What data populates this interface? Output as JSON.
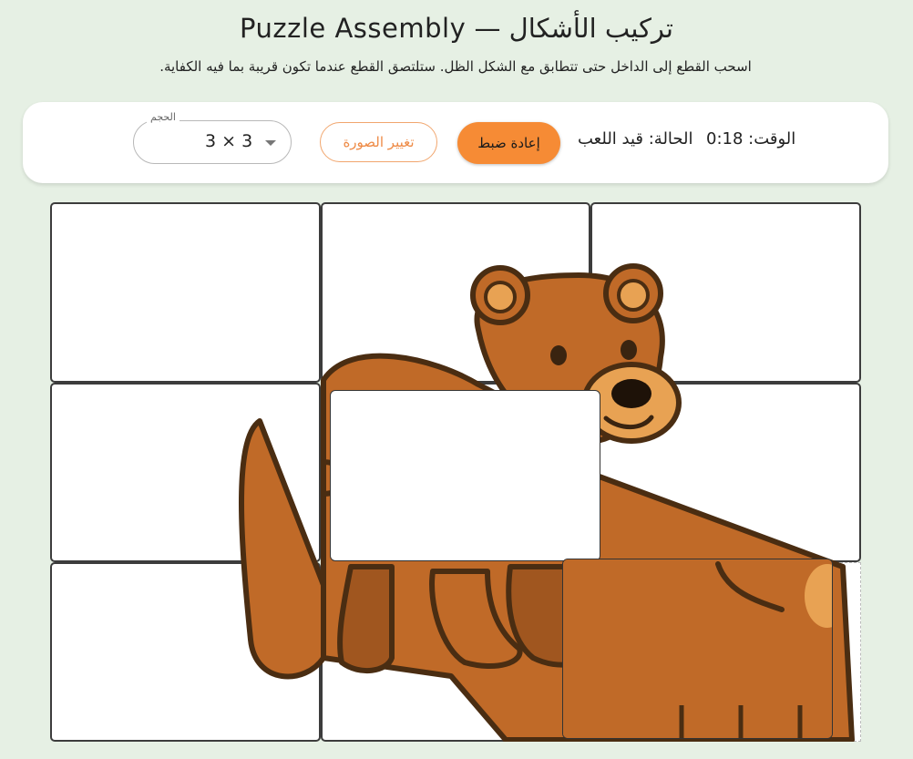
{
  "header": {
    "title": "تركيب الأشكال — Puzzle Assembly",
    "subtitle": "اسحب القطع إلى الداخل حتى تتطابق مع الشكل الظل. ستلتصق القطع عندما تكون قريبة بما فيه الكفاية."
  },
  "toolbar": {
    "size_label": "الحجم",
    "size_value": "3 × 3",
    "change_image_label": "تغيير الصورة",
    "reset_label": "إعادة ضبط",
    "status_text": "الحالة: قيد اللعب",
    "time_text": "الوقت: 0:18"
  },
  "colors": {
    "background": "#e6f0e4",
    "accent": "#f68b35",
    "bear_fur": "#c06a28",
    "bear_dark": "#4a2d12",
    "bear_muzzle": "#e8a253"
  },
  "puzzle": {
    "grid_rows": 3,
    "grid_cols": 3,
    "image_subject": "bear"
  }
}
